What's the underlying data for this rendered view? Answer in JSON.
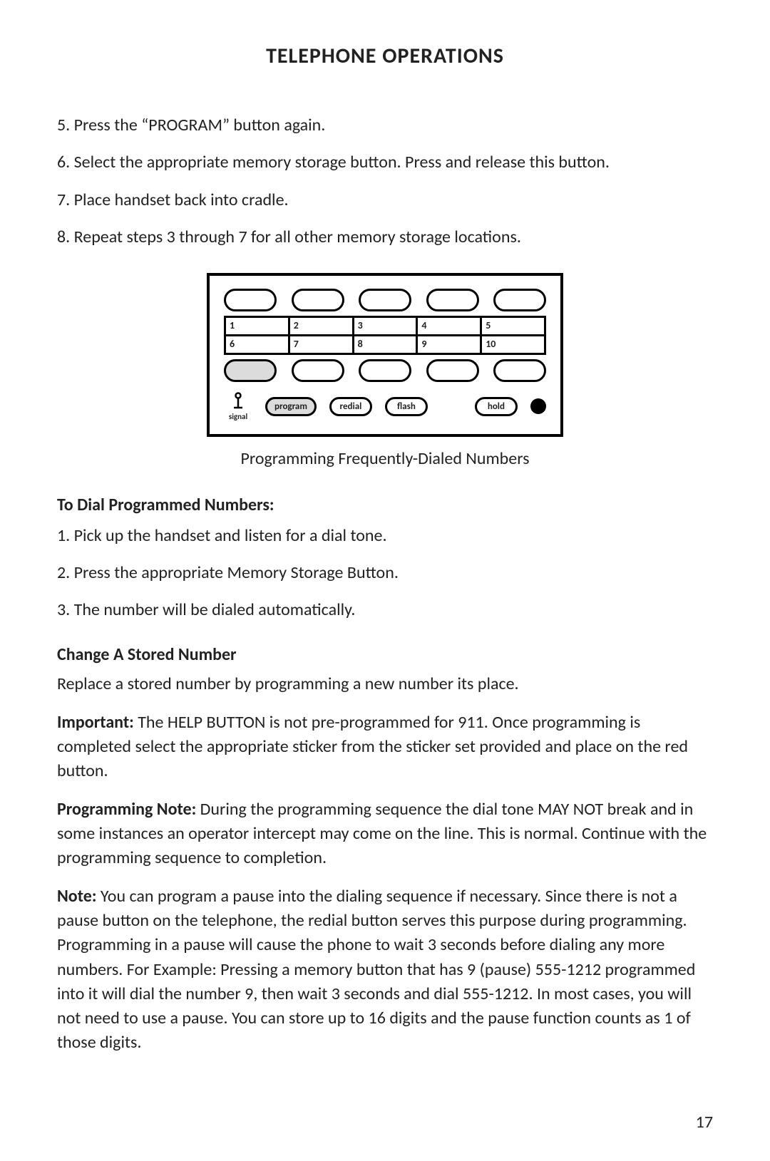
{
  "title": "TELEPHONE OPERATIONS",
  "steps_top": [
    "5. Press the “PROGRAM” button again.",
    "6. Select the appropriate memory storage button. Press and release this button.",
    "7. Place handset back into cradle.",
    "8. Repeat steps 3 through 7 for all other memory storage locations."
  ],
  "diagram": {
    "cells_row1": [
      "1",
      "2",
      "3",
      "4",
      "5"
    ],
    "cells_row2": [
      "6",
      "7",
      "8",
      "9",
      "10"
    ],
    "signal_label": "signal",
    "buttons": {
      "program": "program",
      "redial": "redial",
      "flash": "flash",
      "hold": "hold"
    }
  },
  "caption": "Programming Frequently-Dialed Numbers",
  "dial_head": "To Dial Programmed Numbers:",
  "dial_steps": [
    "1. Pick up the handset and listen for a dial tone.",
    "2. Press the appropriate Memory Storage Button.",
    "3. The number will be dialed automatically."
  ],
  "change_head": "Change A Stored Number",
  "change_body": "Replace a stored number by programming a new number its place.",
  "important_prefix": "Important:",
  "important_body": " The HELP BUTTON is not pre-programmed for 911. Once programming is completed select the appropriate sticker from the sticker set provided and place on the red button.",
  "prognote_prefix": "Programming Note:",
  "prognote_body": " During the programming sequence the dial tone MAY NOT break and in some instances an operator intercept may come on the line. This is normal. Continue with the programming sequence to completion.",
  "note_prefix": "Note:",
  "note_body": " You can program a pause into the dialing sequence if necessary. Since there is not a pause button on the telephone, the redial button serves this purpose during programming. Programming in a pause will cause the phone to wait 3 seconds before dialing any more numbers. For Example: Pressing a memory button that has 9 (pause) 555-1212 programmed into it will dial the number 9, then wait 3 seconds and dial 555-1212. In most cases, you will not need to use a pause. You can store up to 16 digits and the pause function counts as 1 of those digits.",
  "page_number": "17"
}
